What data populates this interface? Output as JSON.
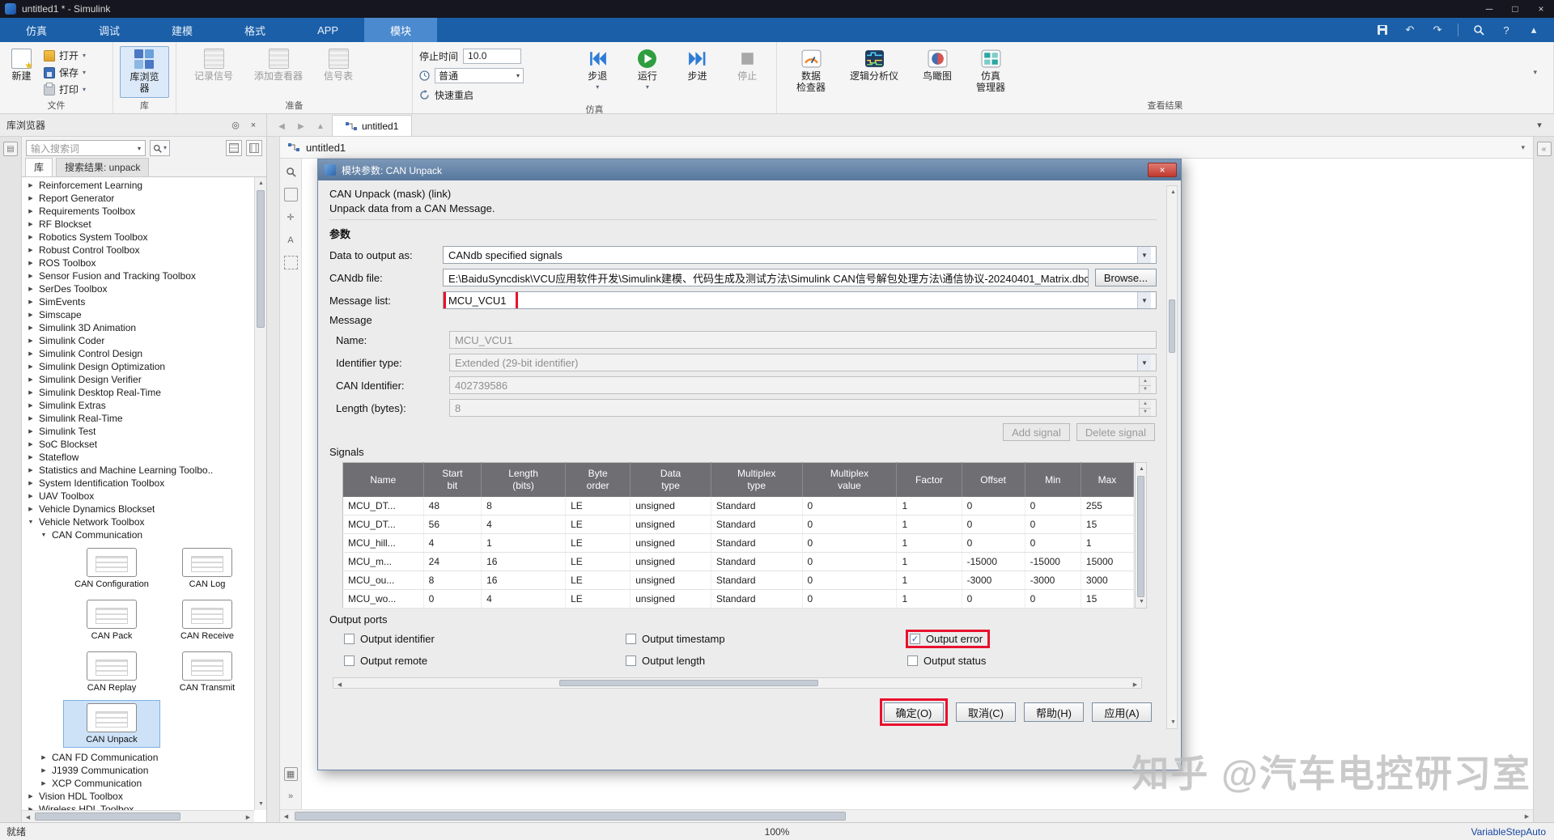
{
  "colors": {
    "titlebar_bg": "#15161f",
    "ribbon_bar": "#1b5fa8",
    "ribbon_tab_active": "#4b8ace",
    "annotation_red": "#e8112d",
    "dialog_titlebar": "#56779d",
    "table_header_bg": "#6e6e73",
    "selection_blue": "#cde2f7",
    "status_link": "#1746a0"
  },
  "window": {
    "title": "untitled1 * - Simulink"
  },
  "ribbon": {
    "tabs": [
      {
        "label": "仿真",
        "active": false
      },
      {
        "label": "调试",
        "active": false
      },
      {
        "label": "建模",
        "active": false
      },
      {
        "label": "格式",
        "active": false
      },
      {
        "label": "APP",
        "active": false
      },
      {
        "label": "模块",
        "active": true
      }
    ]
  },
  "toolbar": {
    "file_group": {
      "label": "文件",
      "buttons": [
        {
          "label": "新建"
        },
        {
          "label": "打开"
        },
        {
          "label": "保存"
        },
        {
          "label": "打印"
        }
      ]
    },
    "library_group": {
      "label": "库",
      "button": "库浏览器"
    },
    "prepare_group": {
      "label": "准备",
      "buttons": [
        {
          "label": "记录信号"
        },
        {
          "label": "添加查看器"
        },
        {
          "label": "信号表"
        }
      ]
    },
    "sim_group": {
      "label": "仿真",
      "stop_time_label": "停止时间",
      "stop_time_value": "10.0",
      "mode": "普通",
      "fast_restart": "快速重启",
      "buttons": [
        {
          "label": "步退"
        },
        {
          "label": "运行"
        },
        {
          "label": "步进"
        },
        {
          "label": "停止"
        }
      ]
    },
    "results_group": {
      "label": "查看结果",
      "buttons": [
        {
          "label": "数据\n检查器"
        },
        {
          "label": "逻辑分析仪"
        },
        {
          "label": "鸟瞰图"
        },
        {
          "label": "仿真\n管理器"
        }
      ]
    }
  },
  "library": {
    "title": "库浏览器",
    "search_placeholder": "输入搜索词",
    "tabs": [
      {
        "label": "库",
        "active": true
      },
      {
        "label": "搜索结果: unpack",
        "active": false
      }
    ],
    "tree": [
      {
        "label": "Reinforcement Learning",
        "state": "collapsed",
        "indent": 0
      },
      {
        "label": "Report Generator",
        "state": "collapsed",
        "indent": 0
      },
      {
        "label": "Requirements Toolbox",
        "state": "collapsed",
        "indent": 0
      },
      {
        "label": "RF Blockset",
        "state": "collapsed",
        "indent": 0
      },
      {
        "label": "Robotics System Toolbox",
        "state": "collapsed",
        "indent": 0
      },
      {
        "label": "Robust Control Toolbox",
        "state": "collapsed",
        "indent": 0
      },
      {
        "label": "ROS Toolbox",
        "state": "collapsed",
        "indent": 0
      },
      {
        "label": "Sensor Fusion and Tracking Toolbox",
        "state": "collapsed",
        "indent": 0
      },
      {
        "label": "SerDes Toolbox",
        "state": "collapsed",
        "indent": 0
      },
      {
        "label": "SimEvents",
        "state": "collapsed",
        "indent": 0
      },
      {
        "label": "Simscape",
        "state": "collapsed",
        "indent": 0
      },
      {
        "label": "Simulink 3D Animation",
        "state": "collapsed",
        "indent": 0
      },
      {
        "label": "Simulink Coder",
        "state": "collapsed",
        "indent": 0
      },
      {
        "label": "Simulink Control Design",
        "state": "collapsed",
        "indent": 0
      },
      {
        "label": "Simulink Design Optimization",
        "state": "collapsed",
        "indent": 0
      },
      {
        "label": "Simulink Design Verifier",
        "state": "collapsed",
        "indent": 0
      },
      {
        "label": "Simulink Desktop Real-Time",
        "state": "collapsed",
        "indent": 0
      },
      {
        "label": "Simulink Extras",
        "state": "collapsed",
        "indent": 0
      },
      {
        "label": "Simulink Real-Time",
        "state": "collapsed",
        "indent": 0
      },
      {
        "label": "Simulink Test",
        "state": "collapsed",
        "indent": 0
      },
      {
        "label": "SoC Blockset",
        "state": "collapsed",
        "indent": 0
      },
      {
        "label": "Stateflow",
        "state": "collapsed",
        "indent": 0
      },
      {
        "label": "Statistics and Machine Learning Toolbo..",
        "state": "collapsed",
        "indent": 0
      },
      {
        "label": "System Identification Toolbox",
        "state": "collapsed",
        "indent": 0
      },
      {
        "label": "UAV Toolbox",
        "state": "collapsed",
        "indent": 0
      },
      {
        "label": "Vehicle Dynamics Blockset",
        "state": "collapsed",
        "indent": 0
      },
      {
        "label": "Vehicle Network Toolbox",
        "state": "expanded",
        "indent": 0
      },
      {
        "label": "CAN Communication",
        "state": "expanded",
        "indent": 1
      },
      {
        "type": "palette"
      },
      {
        "label": "CAN FD Communication",
        "state": "collapsed",
        "indent": 1
      },
      {
        "label": "J1939 Communication",
        "state": "collapsed",
        "indent": 1
      },
      {
        "label": "XCP Communication",
        "state": "collapsed",
        "indent": 1
      },
      {
        "label": "Vision HDL Toolbox",
        "state": "collapsed",
        "indent": 0
      },
      {
        "label": "Wireless HDL Toolbox",
        "state": "collapsed",
        "indent": 0
      }
    ],
    "palette": [
      {
        "label": "CAN Configuration"
      },
      {
        "label": "CAN Log"
      },
      {
        "label": "CAN Pack"
      },
      {
        "label": "CAN Receive"
      },
      {
        "label": "CAN Replay"
      },
      {
        "label": "CAN Transmit"
      },
      {
        "label": "CAN Unpack",
        "selected": true
      }
    ]
  },
  "canvas": {
    "tab": "untitled1",
    "breadcrumb": "untitled1",
    "watermark": "知乎 @汽车电控研习室"
  },
  "dialog": {
    "title": "模块参数: CAN Unpack",
    "mask_line": "CAN Unpack (mask) (link)",
    "description": "Unpack data from a CAN Message.",
    "params_header": "参数",
    "data_to_output": {
      "label": "Data to output as:",
      "value": "CANdb specified signals"
    },
    "candb_file": {
      "label": "CANdb file:",
      "value": "E:\\BaiduSyncdisk\\VCU应用软件开发\\Simulink建模、代码生成及测试方法\\Simulink CAN信号解包处理方法\\通信协议-20240401_Matrix.dbc",
      "browse": "Browse..."
    },
    "message_list": {
      "label": "Message list:",
      "value": "MCU_VCU1"
    },
    "message_group": {
      "header": "Message",
      "name": {
        "label": "Name:",
        "value": "MCU_VCU1"
      },
      "identifier_type": {
        "label": "Identifier type:",
        "value": "Extended (29-bit identifier)"
      },
      "can_identifier": {
        "label": "CAN Identifier:",
        "value": "402739586"
      },
      "length_bytes": {
        "label": "Length (bytes):",
        "value": "8"
      }
    },
    "add_signal": "Add signal",
    "delete_signal": "Delete signal",
    "signals_header": "Signals",
    "table": {
      "columns": [
        [
          "Name"
        ],
        [
          "Start",
          "bit"
        ],
        [
          "Length",
          "(bits)"
        ],
        [
          "Byte",
          "order"
        ],
        [
          "Data",
          "type"
        ],
        [
          "Multiplex",
          "type"
        ],
        [
          "Multiplex",
          "value"
        ],
        [
          "Factor"
        ],
        [
          "Offset"
        ],
        [
          "Min"
        ],
        [
          "Max"
        ]
      ],
      "rows": [
        [
          "MCU_DT...",
          "48",
          "8",
          "LE",
          "unsigned",
          "Standard",
          "0",
          "1",
          "0",
          "0",
          "255"
        ],
        [
          "MCU_DT...",
          "56",
          "4",
          "LE",
          "unsigned",
          "Standard",
          "0",
          "1",
          "0",
          "0",
          "15"
        ],
        [
          "MCU_hill...",
          "4",
          "1",
          "LE",
          "unsigned",
          "Standard",
          "0",
          "1",
          "0",
          "0",
          "1"
        ],
        [
          "MCU_m...",
          "24",
          "16",
          "LE",
          "unsigned",
          "Standard",
          "0",
          "1",
          "-15000",
          "-15000",
          "15000"
        ],
        [
          "MCU_ou...",
          "8",
          "16",
          "LE",
          "unsigned",
          "Standard",
          "0",
          "1",
          "-3000",
          "-3000",
          "3000"
        ],
        [
          "MCU_wo...",
          "0",
          "4",
          "LE",
          "unsigned",
          "Standard",
          "0",
          "1",
          "0",
          "0",
          "15"
        ]
      ]
    },
    "output_ports": {
      "header": "Output ports",
      "checkboxes": [
        {
          "label": "Output identifier",
          "checked": false,
          "highlight": false
        },
        {
          "label": "Output timestamp",
          "checked": false,
          "highlight": false
        },
        {
          "label": "Output error",
          "checked": true,
          "highlight": true
        },
        {
          "label": "Output remote",
          "checked": false,
          "highlight": false
        },
        {
          "label": "Output length",
          "checked": false,
          "highlight": false
        },
        {
          "label": "Output status",
          "checked": false,
          "highlight": false
        }
      ]
    },
    "buttons": [
      {
        "label": "确定(O)",
        "highlight": true
      },
      {
        "label": "取消(C)",
        "highlight": false
      },
      {
        "label": "帮助(H)",
        "highlight": false
      },
      {
        "label": "应用(A)",
        "highlight": false
      }
    ]
  },
  "status_bar": {
    "left": "就绪",
    "zoom": "100%",
    "right": "VariableStepAuto"
  }
}
